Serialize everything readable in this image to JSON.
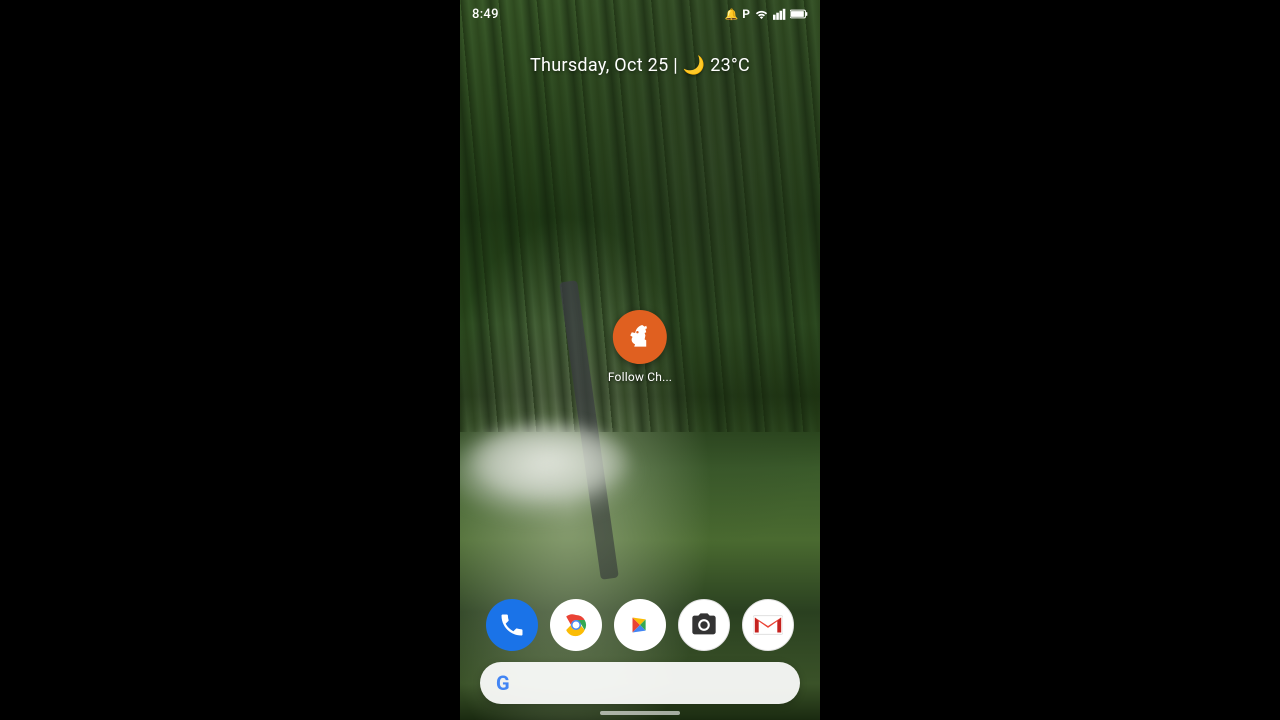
{
  "statusBar": {
    "time": "8:49",
    "icons": [
      "notifications",
      "p-icon",
      "wifi",
      "signal",
      "battery"
    ]
  },
  "dateWeather": {
    "text": "Thursday, Oct 25 | 🌙 23°C"
  },
  "centerApp": {
    "name": "Follow Ch...",
    "iconColor": "#e06020"
  },
  "dock": [
    {
      "id": "phone",
      "label": "Phone"
    },
    {
      "id": "chrome",
      "label": "Chrome"
    },
    {
      "id": "play",
      "label": "Play Store"
    },
    {
      "id": "camera",
      "label": "Camera"
    },
    {
      "id": "gmail",
      "label": "Gmail"
    }
  ],
  "searchBar": {
    "gLetter": "G",
    "placeholder": ""
  }
}
